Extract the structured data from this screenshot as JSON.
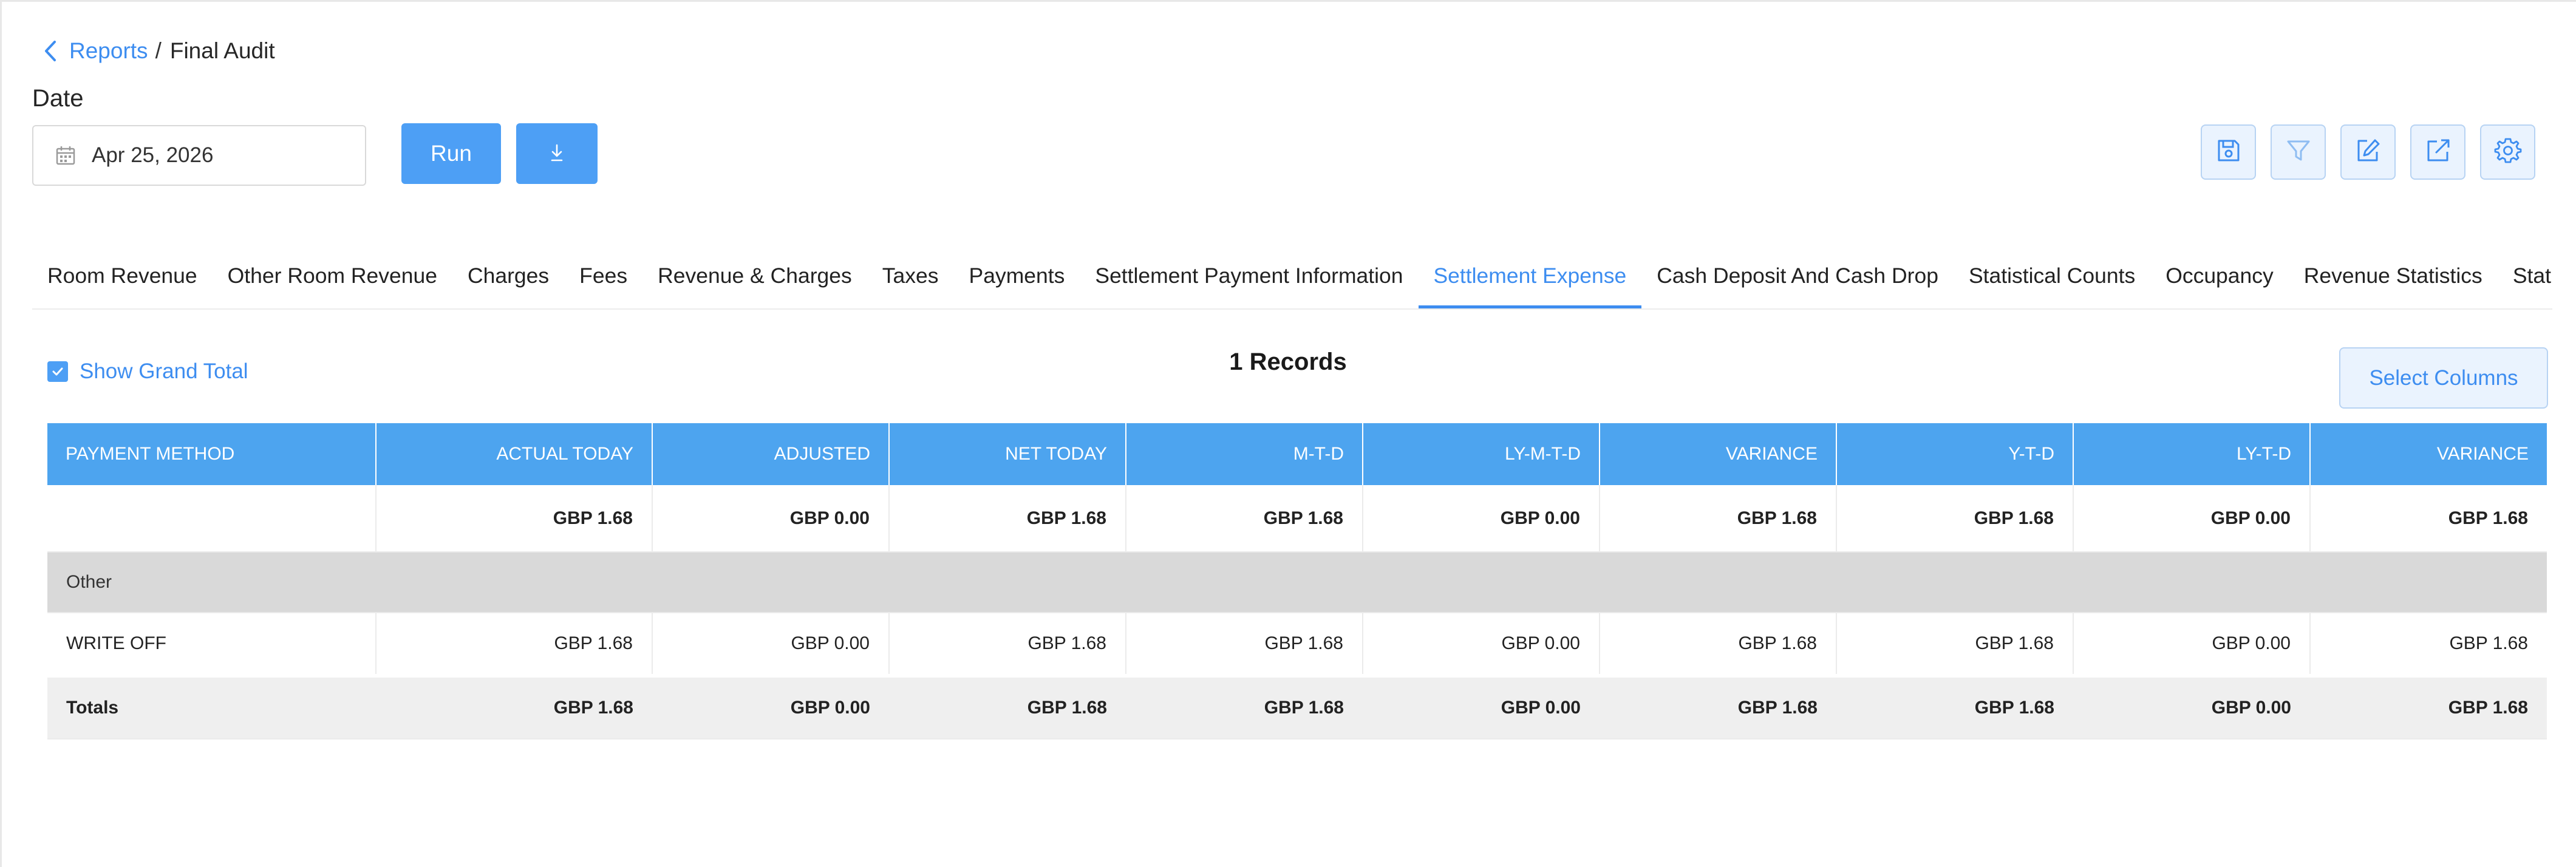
{
  "breadcrumb": {
    "parent": "Reports",
    "separator": "/",
    "current": "Final Audit"
  },
  "date": {
    "label": "Date",
    "value": "Apr 25, 2026"
  },
  "actions": {
    "run_label": "Run"
  },
  "toolbar": {
    "icons": [
      "save-icon",
      "filter-icon",
      "edit-icon",
      "export-icon",
      "settings-icon"
    ]
  },
  "tabs": {
    "items": [
      "Room Revenue",
      "Other Room Revenue",
      "Charges",
      "Fees",
      "Revenue & Charges",
      "Taxes",
      "Payments",
      "Settlement Payment Information",
      "Settlement Expense",
      "Cash Deposit And Cash Drop",
      "Statistical Counts",
      "Occupancy",
      "Revenue Statistics",
      "Statis"
    ],
    "active_index": 8
  },
  "controls": {
    "show_grand_total_label": "Show Grand Total",
    "show_grand_total_checked": true,
    "records_text": "1 Records",
    "select_columns_label": "Select Columns"
  },
  "table": {
    "headers": [
      "PAYMENT METHOD",
      "ACTUAL TODAY",
      "ADJUSTED",
      "NET TODAY",
      "M-T-D",
      "LY-M-T-D",
      "VARIANCE",
      "Y-T-D",
      "LY-T-D",
      "VARIANCE"
    ],
    "summary_row": [
      "",
      "GBP 1.68",
      "GBP 0.00",
      "GBP 1.68",
      "GBP 1.68",
      "GBP 0.00",
      "GBP 1.68",
      "GBP 1.68",
      "GBP 0.00",
      "GBP 1.68"
    ],
    "group_label": "Other",
    "rows": [
      [
        "WRITE OFF",
        "GBP 1.68",
        "GBP 0.00",
        "GBP 1.68",
        "GBP 1.68",
        "GBP 0.00",
        "GBP 1.68",
        "GBP 1.68",
        "GBP 0.00",
        "GBP 1.68"
      ]
    ],
    "totals_row": [
      "Totals",
      "GBP 1.68",
      "GBP 0.00",
      "GBP 1.68",
      "GBP 1.68",
      "GBP 0.00",
      "GBP 1.68",
      "GBP 1.68",
      "GBP 0.00",
      "GBP 1.68"
    ]
  },
  "colors": {
    "accent": "#4d9ff5",
    "header_bg": "#4da4ef",
    "link": "#3d8df0",
    "group_bg": "#d9d9d9",
    "totals_bg": "#efefef"
  }
}
